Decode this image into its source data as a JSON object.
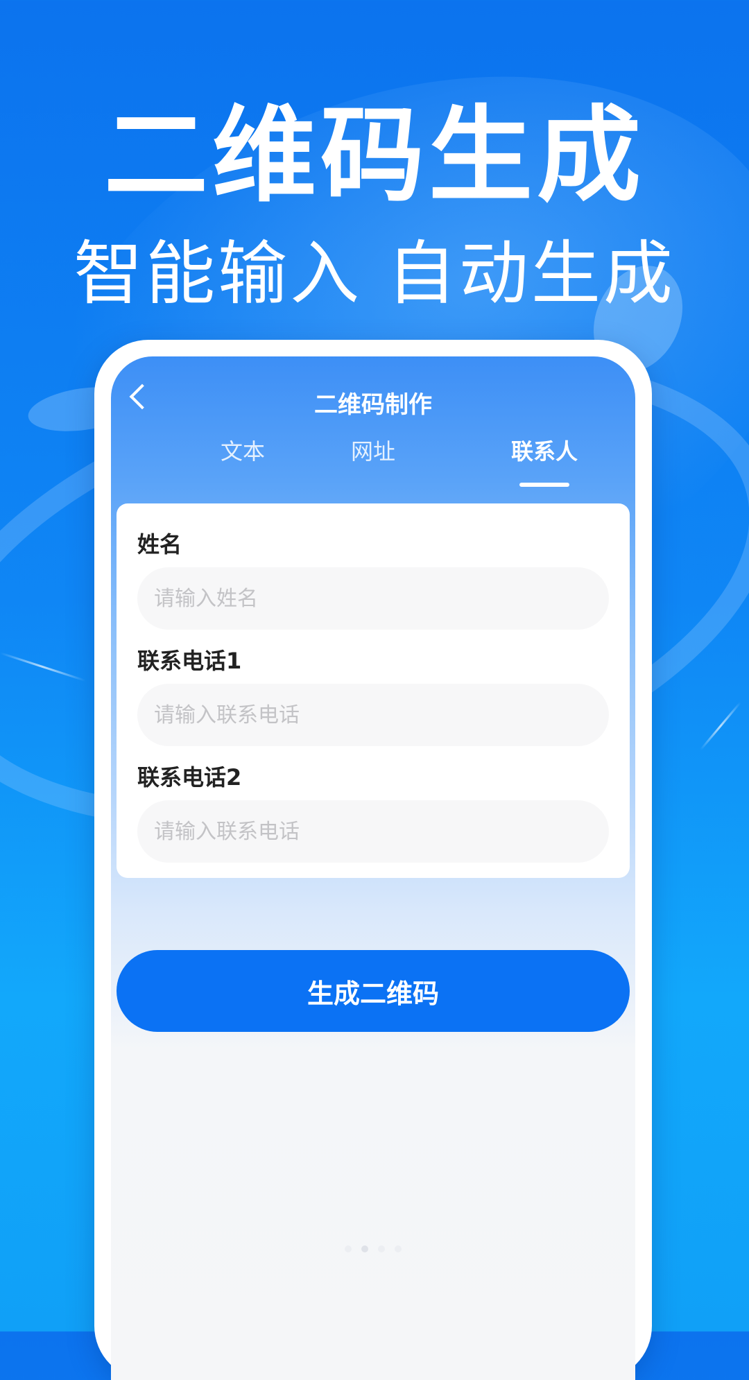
{
  "hero": {
    "title": "二维码生成",
    "subtitle": "智能输入 自动生成"
  },
  "nav": {
    "title": "二维码制作",
    "back_icon": "chevron-left-icon"
  },
  "tabs": [
    {
      "label": "文本",
      "active": false
    },
    {
      "label": "网址",
      "active": false
    },
    {
      "label": "联系人",
      "active": true
    }
  ],
  "form": {
    "fields": [
      {
        "label": "姓名",
        "placeholder": "请输入姓名",
        "value": ""
      },
      {
        "label": "联系电话1",
        "placeholder": "请输入联系电话",
        "value": ""
      },
      {
        "label": "联系电话2",
        "placeholder": "请输入联系电话",
        "value": ""
      }
    ]
  },
  "actions": {
    "generate_label": "生成二维码"
  },
  "pager": {
    "count": 4,
    "active_index": 1
  },
  "colors": {
    "background": "#0f86f5",
    "accent": "#0b72f4",
    "header": "#3d8ff6",
    "input_bg": "#f7f7f8",
    "placeholder": "#c3c3c6"
  }
}
